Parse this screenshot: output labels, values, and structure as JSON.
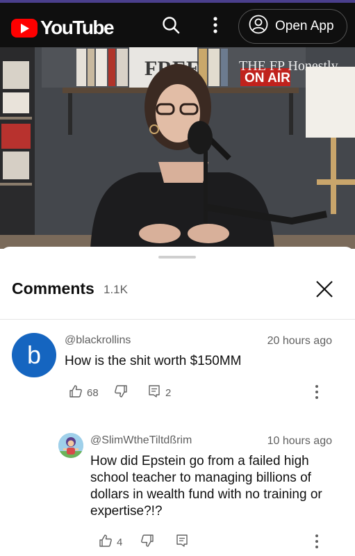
{
  "app": {
    "name": "YouTube",
    "open_app_label": "Open App"
  },
  "icons": {
    "search": "search-icon",
    "more": "more-vert-icon",
    "account": "account-circle-icon",
    "close": "close-icon",
    "like": "thumbs-up-icon",
    "dislike": "thumbs-down-icon",
    "reply": "reply-icon"
  },
  "video": {
    "overlay_logo": "THE FP Honestly",
    "on_air": "ON AIR",
    "book_text": "FREE"
  },
  "comments": {
    "title": "Comments",
    "count": "1.1K",
    "items": [
      {
        "author": "@blackrollins",
        "avatar_letter": "b",
        "time": "20 hours ago",
        "text": "How is the shit worth $150MM",
        "likes": "68",
        "replies": "2"
      },
      {
        "author": "@SlimWtheTiltdßrim",
        "time": "10 hours ago",
        "text_lines": [
          "How did Epstein go from a failed high",
          "school teacher to managing billions of",
          "dollars in wealth fund with no training or",
          "expertise?!?"
        ],
        "likes": "4"
      }
    ]
  },
  "colors": {
    "brand_red": "#ff0000",
    "avatar_blue": "#1565c0",
    "appbar": "#0f0f0f"
  }
}
